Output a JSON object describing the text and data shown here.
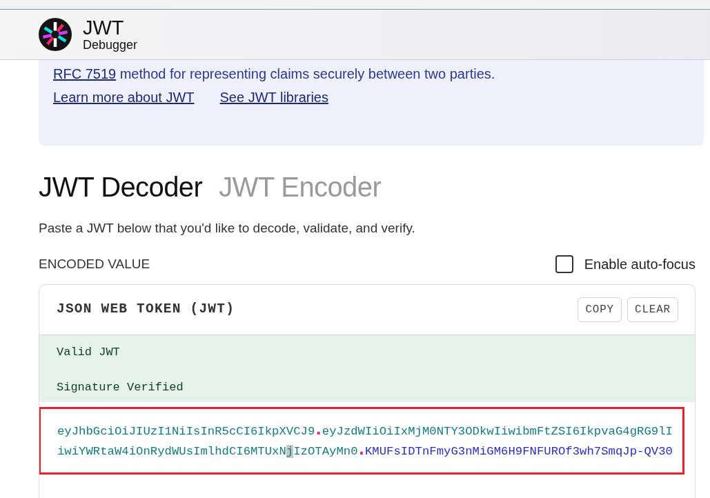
{
  "header": {
    "title": "JWT",
    "subtitle": "Debugger"
  },
  "intro": {
    "link": "RFC 7519",
    "text": "method for representing claims securely between two parties.",
    "links": [
      "Learn more about JWT",
      "See JWT libraries"
    ]
  },
  "tabs": [
    {
      "label": "JWT Decoder",
      "selected": true
    },
    {
      "label": "JWT Encoder",
      "selected": false
    }
  ],
  "description": "Paste a JWT below that you'd like to decode, validate, and verify.",
  "encoded_value": {
    "label": "ENCODED VALUE",
    "auto_focus": {
      "label": "Enable auto-focus",
      "checked": false
    }
  },
  "token_card": {
    "title": "JSON WEB TOKEN (JWT)",
    "buttons": [
      "COPY",
      "CLEAR"
    ],
    "valid": true,
    "status": [
      "Valid JWT",
      "Signature Verified"
    ],
    "token": {
      "highlighted": true,
      "parts": [
        {
          "text": "eyJhbGciOiJIUzI1NiIsInR5cCI6IkpXVCJ9",
          "color": "#167a7e",
          "selected": false
        },
        {
          "text": ".",
          "color": "#d2339e",
          "selected": false
        },
        {
          "text": "eyJzdWIiOiIxMjM0NTY3ODkwIiwibmFtZSI6IkpvaG4gRG9lIiwiYWRtaW4iOnRydWUsImlhdCI6MTUxN",
          "color": "#167a7e",
          "selected": false
        },
        {
          "text": "j",
          "color": "#167a7e",
          "selected": true
        },
        {
          "text": "IzOTAyMn0",
          "color": "#167a7e",
          "selected": false
        },
        {
          "text": ".",
          "color": "#d2339e",
          "selected": false
        },
        {
          "text": "KMUFsIDTnFmyG3nMiGM6H9FNFUROf3wh7SmqJp-QV30",
          "color": "#2b2fbf",
          "selected": false
        }
      ]
    }
  }
}
